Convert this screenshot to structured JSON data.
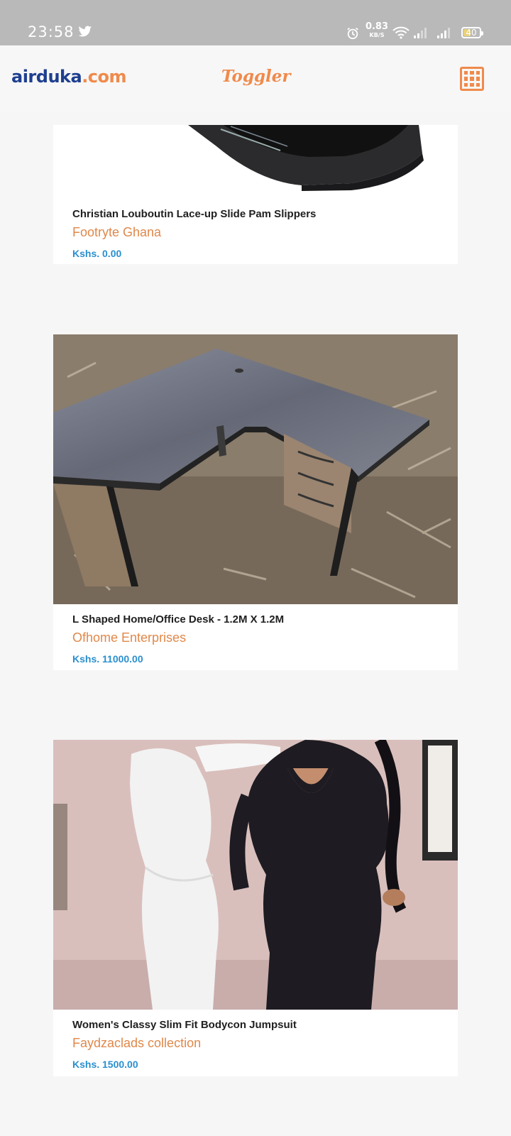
{
  "status_bar": {
    "time": "23:58",
    "net_speed_value": "0.83",
    "net_speed_unit": "KB/S",
    "battery": "40",
    "icons": [
      "twitter-icon",
      "alarm-icon",
      "wifi-icon",
      "signal-icon",
      "signal-icon",
      "battery-icon"
    ]
  },
  "header": {
    "logo_brand": "airduka",
    "logo_suffix": ".com",
    "toggler_label": "Toggler",
    "menu_icon": "grid-menu-icon"
  },
  "colors": {
    "brand_blue": "#1f3f8f",
    "accent_orange": "#f08a4b",
    "seller_orange": "#e0884a",
    "price_blue": "#2a8fcf"
  },
  "products": [
    {
      "title": "Christian Louboutin Lace-up Slide Pam Slippers",
      "seller": "Footryte Ghana",
      "price": "Kshs. 0.00",
      "image": "slipper-photo"
    },
    {
      "title": "L Shaped Home/Office Desk - 1.2M X 1.2M",
      "seller": "Ofhome Enterprises",
      "price": "Kshs. 11000.00",
      "image": "desk-photo"
    },
    {
      "title": "Women's Classy Slim Fit Bodycon Jumpsuit",
      "seller": "Faydzaclads collection",
      "price": "Kshs. 1500.00",
      "image": "jumpsuit-photo"
    }
  ]
}
